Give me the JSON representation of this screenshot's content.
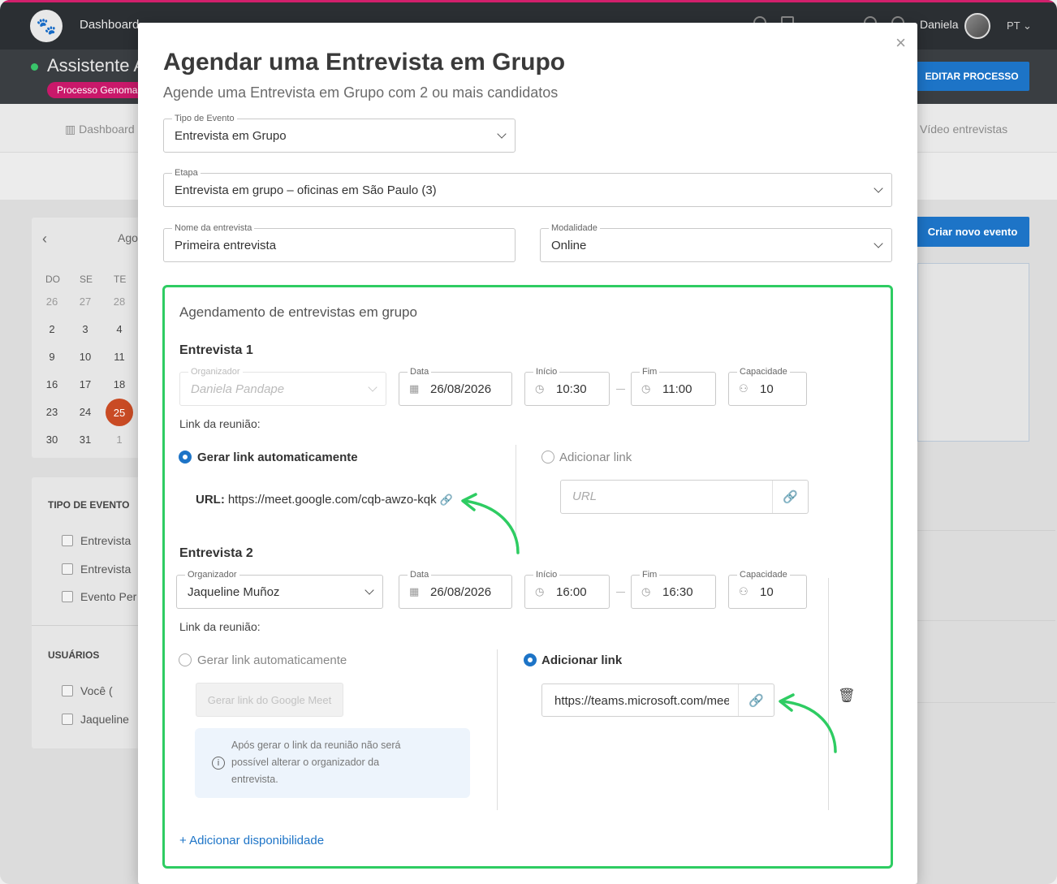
{
  "app": {
    "nav_dashboard": "Dashboard",
    "user_name": "Daniela",
    "lang": "PT",
    "page_title": "Assistente A",
    "process_badge": "Processo Genoma",
    "edit_process": "EDITAR PROCESSO",
    "tab_dashboard": "Dashboard",
    "tab_video": "Vídeo entrevistas",
    "create_event": "Criar novo evento",
    "accent_color": "#1d74c7",
    "brand_color": "#d1206c"
  },
  "calendar": {
    "month_label": "Ago",
    "weekdays": [
      "DO",
      "SE",
      "TE"
    ],
    "rows": [
      [
        "26",
        "27",
        "28"
      ],
      [
        "2",
        "3",
        "4"
      ],
      [
        "9",
        "10",
        "11"
      ],
      [
        "16",
        "17",
        "18"
      ],
      [
        "23",
        "24",
        "25"
      ],
      [
        "30",
        "31",
        "1"
      ]
    ],
    "today": "25"
  },
  "filters": {
    "event_type_title": "TIPO DE EVENTO",
    "event_types": [
      "Entrevista",
      "Entrevista",
      "Evento Per"
    ],
    "users_title": "USUÁRIOS",
    "users": [
      "Você (",
      "Jaqueline"
    ]
  },
  "modal": {
    "title": "Agendar uma Entrevista em Grupo",
    "subtitle": "Agende uma Entrevista em Grupo com 2 ou mais candidatos",
    "event_type_label": "Tipo de Evento",
    "event_type_value": "Entrevista em Grupo",
    "stage_label": "Etapa",
    "stage_value": "Entrevista em grupo – oficinas em São Paulo (3)",
    "interview_name_label": "Nome da entrevista",
    "interview_name_value": "Primeira entrevista",
    "modality_label": "Modalidade",
    "modality_value": "Online",
    "group_section_title": "Agendamento de entrevistas em grupo",
    "add_availability": "+ Adicionar disponibilidade",
    "highlight_color": "#2ecc62"
  },
  "labels": {
    "organizer": "Organizador",
    "date": "Data",
    "start": "Início",
    "end": "Fim",
    "capacity": "Capacidade",
    "meeting_link": "Link da reunião:",
    "auto_link": "Gerar link automaticamente",
    "add_link": "Adicionar link",
    "url_label": "URL:",
    "url_placeholder": "URL",
    "gen_meet_button": "Gerar link do Google Meet",
    "info_text": "Após gerar o link da reunião não será possível alterar o organizador da entrevista."
  },
  "interviews": [
    {
      "title": "Entrevista 1",
      "organizer": "Daniela Pandape",
      "date": "26/08/2026",
      "start": "10:30",
      "end": "11:00",
      "capacity": "10",
      "link_mode": "auto",
      "url": "https://meet.google.com/cqb-awzo-kqk"
    },
    {
      "title": "Entrevista 2",
      "organizer": "Jaqueline Muñoz",
      "date": "26/08/2026",
      "start": "16:00",
      "end": "16:30",
      "capacity": "10",
      "link_mode": "manual",
      "url": "https://teams.microsoft.com/meet"
    }
  ]
}
